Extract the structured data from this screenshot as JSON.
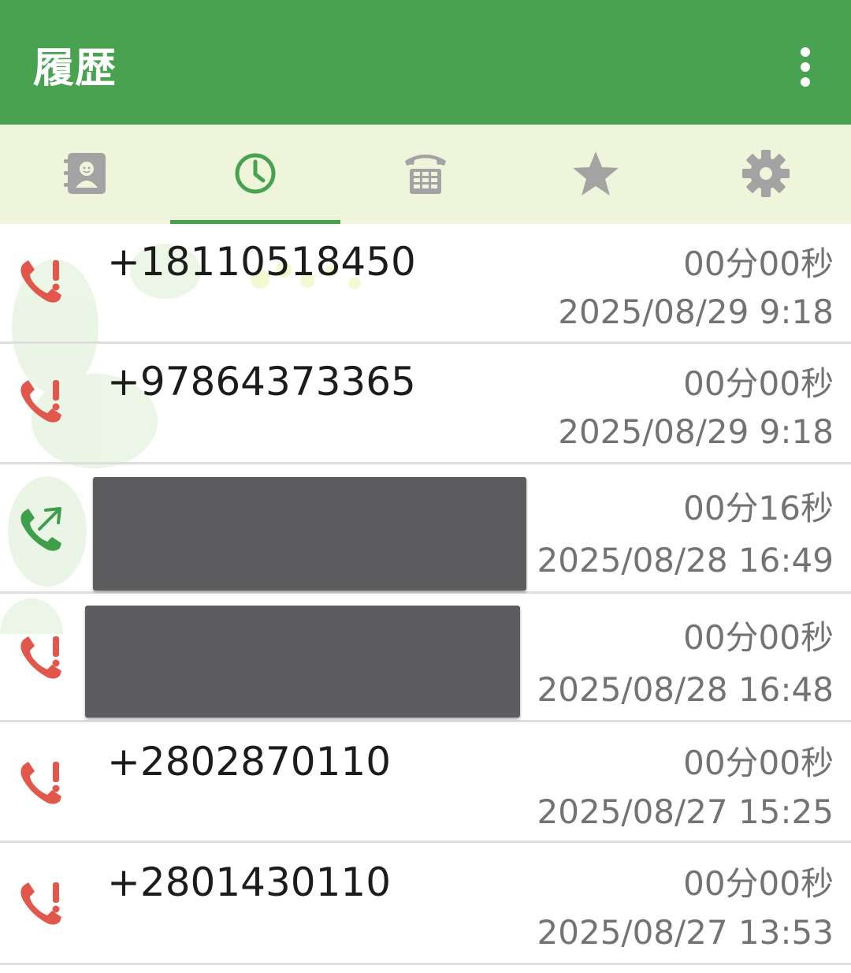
{
  "appbar": {
    "title": "履歴",
    "overflow_icon": "more-vert-icon",
    "color": "#48a24f"
  },
  "tabs": [
    {
      "icon": "contacts-icon",
      "selected": false
    },
    {
      "icon": "history-clock-icon",
      "selected": true
    },
    {
      "icon": "dialpad-phone-icon",
      "selected": false
    },
    {
      "icon": "star-icon",
      "selected": false
    },
    {
      "icon": "settings-gear-icon",
      "selected": false
    }
  ],
  "colors": {
    "tab_bg": "#eef5da",
    "accent": "#48a24f",
    "missed": "#e2574c",
    "outgoing": "#3e9e4a",
    "secondary_text": "#737373"
  },
  "calls": [
    {
      "type": "missed",
      "number": "+18110518450",
      "duration": "00分00秒",
      "datetime": "2025/08/29 9:18"
    },
    {
      "type": "missed",
      "number": "+97864373365",
      "duration": "00分00秒",
      "datetime": "2025/08/29 9:18"
    },
    {
      "type": "outgoing",
      "number": "",
      "duration": "00分16秒",
      "datetime": "2025/08/28 16:49"
    },
    {
      "type": "missed",
      "number": "",
      "duration": "00分00秒",
      "datetime": "2025/08/28 16:48"
    },
    {
      "type": "missed",
      "number": "+2802870110",
      "duration": "00分00秒",
      "datetime": "2025/08/27 15:25"
    },
    {
      "type": "missed",
      "number": "+2801430110",
      "duration": "00分00秒",
      "datetime": "2025/08/27 13:53"
    }
  ]
}
